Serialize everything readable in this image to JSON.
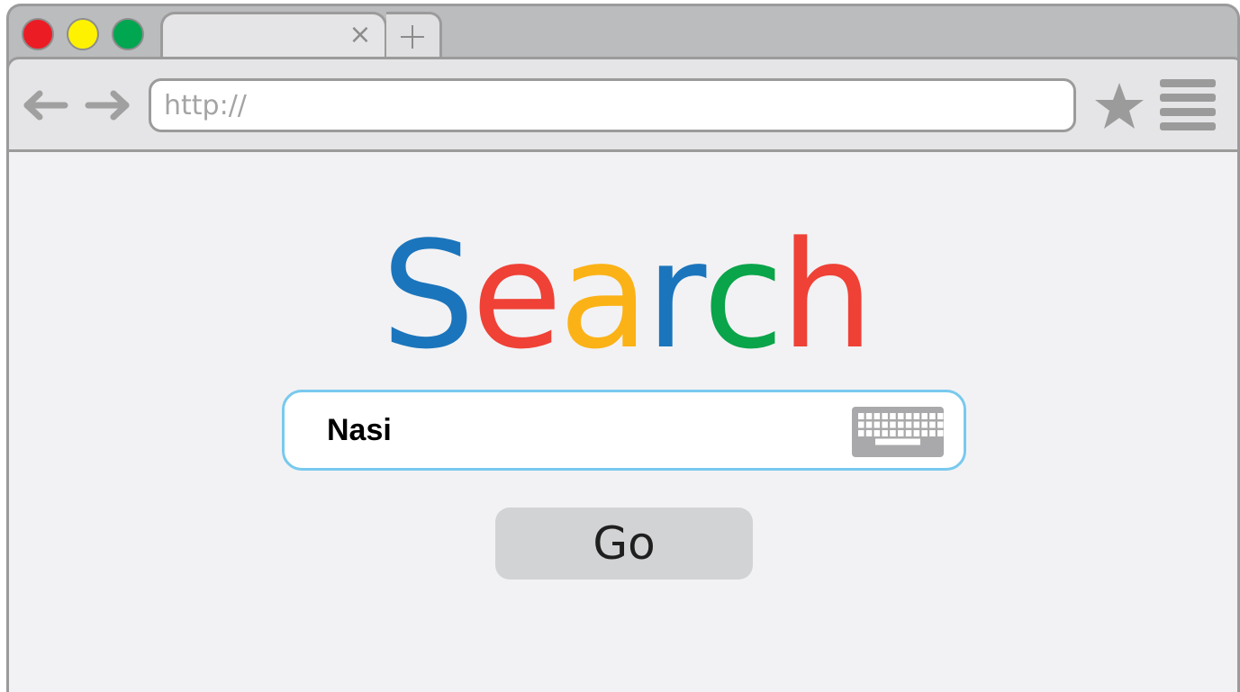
{
  "window": {
    "traffic_lights": {
      "close_color": "#ec1c24",
      "minimize_color": "#fff200",
      "maximize_color": "#00a650"
    }
  },
  "tabs": [
    {
      "label": "",
      "close_icon": "close-icon",
      "active": true
    }
  ],
  "new_tab_icon": "plus-icon",
  "toolbar": {
    "back_icon": "arrow-left-icon",
    "forward_icon": "arrow-right-icon",
    "address": {
      "value": "http://"
    },
    "bookmark_icon": "star-icon",
    "menu_icon": "hamburger-menu-icon"
  },
  "page": {
    "logo": {
      "letters": [
        {
          "char": "S",
          "color": "#1b75bc"
        },
        {
          "char": "e",
          "color": "#ef4136"
        },
        {
          "char": "a",
          "color": "#fbb216"
        },
        {
          "char": "r",
          "color": "#1b75bc"
        },
        {
          "char": "c",
          "color": "#0aa44a"
        },
        {
          "char": "h",
          "color": "#ef4136"
        }
      ]
    },
    "search": {
      "value": "Nasi",
      "border_color": "#78c9ee",
      "keyboard_icon": "keyboard-icon"
    },
    "go_button": {
      "label": "Go"
    }
  }
}
